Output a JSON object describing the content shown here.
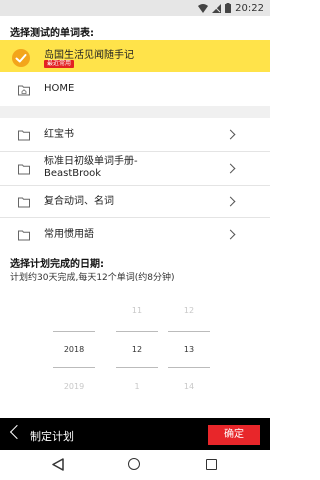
{
  "status_bar": {
    "time": "20:22",
    "icons": [
      "wifi-icon",
      "signal-icon",
      "battery-icon"
    ]
  },
  "select_section": {
    "title": "选择测试的单词表:"
  },
  "selected_book": {
    "title": "岛国生活见闻随手记",
    "badge": "最近常用"
  },
  "home": {
    "label": "HOME"
  },
  "books": [
    {
      "label": "红宝书"
    },
    {
      "label": "标准日初级单词手册-\nBeastBrook"
    },
    {
      "label": "复合动词、名词"
    },
    {
      "label": "常用惯用語"
    }
  ],
  "plan": {
    "title": "选择计划完成的日期:",
    "subtitle": "计划约30天完成,每天12个单词(约8分钟)"
  },
  "picker": {
    "year": {
      "prev": "",
      "selected": "2018",
      "next": "2019"
    },
    "month": {
      "prev": "11",
      "selected": "12",
      "next": "1"
    },
    "day": {
      "prev": "12",
      "selected": "13",
      "next": "14"
    }
  },
  "bottom_bar": {
    "title": "制定计划",
    "confirm": "确定"
  },
  "colors": {
    "highlight": "#ffe34a",
    "check": "#f3a51b",
    "badge": "#e32222",
    "confirm": "#e8262a"
  }
}
